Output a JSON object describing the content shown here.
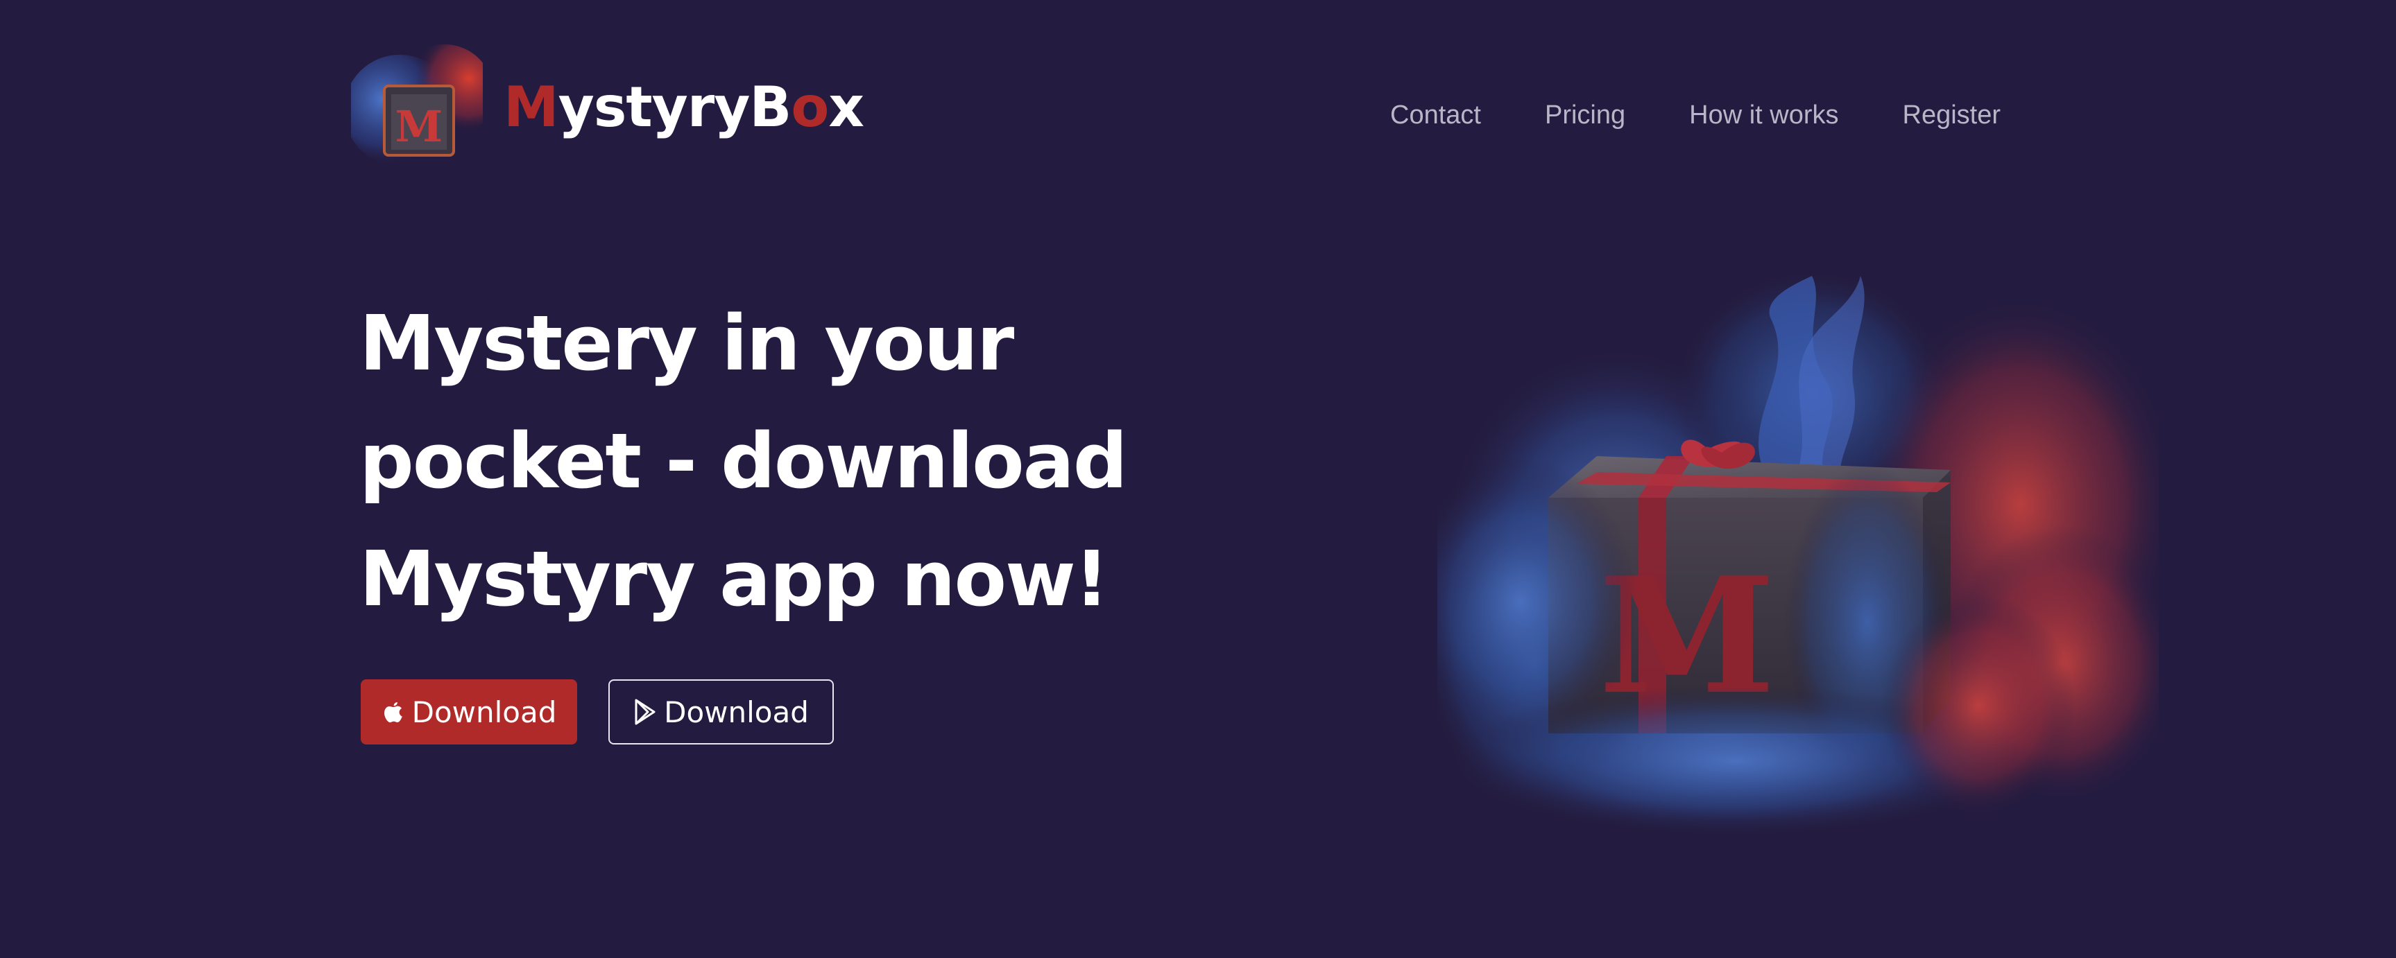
{
  "brand": {
    "name_first": "M",
    "name_middle": "ystyryB",
    "name_accent": "o",
    "name_last": "x",
    "logo_letter": "M"
  },
  "nav": {
    "items": [
      {
        "label": "Contact"
      },
      {
        "label": "Pricing"
      },
      {
        "label": "How it works"
      },
      {
        "label": "Register"
      }
    ]
  },
  "hero": {
    "title_line1": "Mystery in your",
    "title_line2": "pocket - download",
    "title_line3": "Mystyry app now!",
    "hero_letter": "M"
  },
  "buttons": {
    "ios_label": "Download",
    "android_label": "Download",
    "ios_icon": "apple-icon",
    "android_icon": "play-store-icon"
  },
  "colors": {
    "background": "#241c40",
    "accent": "#b02a2a",
    "nav_text": "#b9b6c8",
    "text": "#ffffff"
  }
}
